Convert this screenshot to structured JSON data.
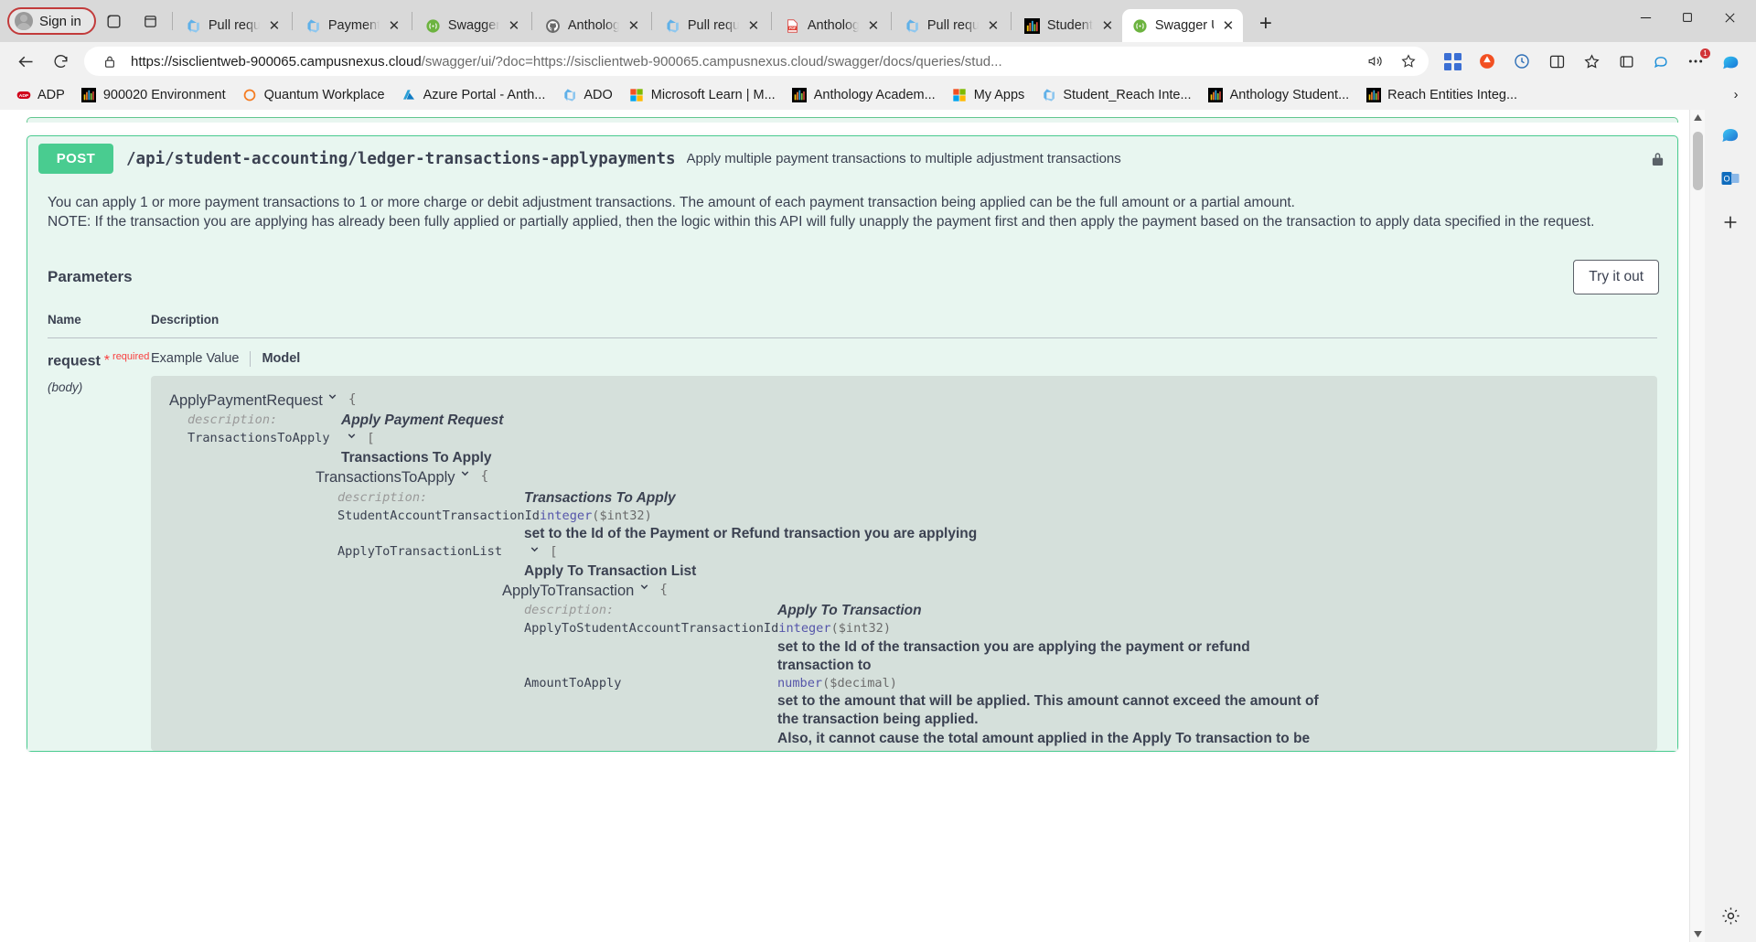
{
  "browser": {
    "signin_label": "Sign in",
    "tabs": [
      {
        "label": "Pull request",
        "favicon": "azure-devops-icon"
      },
      {
        "label": "PaymentSer",
        "favicon": "azure-devops-icon"
      },
      {
        "label": "Swagger Ed",
        "favicon": "swagger-icon"
      },
      {
        "label": "Anthology",
        "favicon": "github-icon"
      },
      {
        "label": "Pull request",
        "favicon": "azure-devops-icon"
      },
      {
        "label": "Anthology",
        "favicon": "pdf-icon"
      },
      {
        "label": "Pull request",
        "favicon": "azure-devops-icon"
      },
      {
        "label": "Student",
        "favicon": "powerbi-icon"
      },
      {
        "label": "Swagger UI",
        "favicon": "swagger-icon"
      }
    ],
    "active_tab_index": 8,
    "new_tab_label": "+",
    "window_controls": {
      "minimize": "–",
      "maximize": "□",
      "close": "✕"
    },
    "address": {
      "url_strong": "https://sisclientweb-900065.campusnexus.cloud",
      "url_dim": "/swagger/ui/?doc=https://sisclientweb-900065.campusnexus.cloud/swagger/docs/queries/stud...",
      "lock_icon": "lock-icon",
      "read_aloud_icon": "read-aloud-icon",
      "favorite_icon": "star-icon"
    },
    "toolbar_icons": [
      "collections-icon",
      "browser-essentials-icon",
      "split-screen-icon",
      "favorites-icon",
      "add-to-collections-icon",
      "copilot-icon",
      "extensions-icon",
      "settings-more-icon"
    ],
    "bookmarks": [
      {
        "label": "ADP",
        "icon": "adp-icon"
      },
      {
        "label": "900020 Environment",
        "icon": "powerbi-icon"
      },
      {
        "label": "Quantum Workplace",
        "icon": "quantum-icon"
      },
      {
        "label": "Azure Portal - Anth...",
        "icon": "azure-icon"
      },
      {
        "label": "ADO",
        "icon": "azure-devops-icon"
      },
      {
        "label": "Microsoft Learn | M...",
        "icon": "microsoft-icon"
      },
      {
        "label": "Anthology Academ...",
        "icon": "powerbi-icon"
      },
      {
        "label": "My Apps",
        "icon": "microsoft-icon"
      },
      {
        "label": "Student_Reach Inte...",
        "icon": "azure-devops-icon"
      },
      {
        "label": "Anthology Student...",
        "icon": "powerbi-icon"
      },
      {
        "label": "Reach Entities Integ...",
        "icon": "powerbi-icon"
      }
    ],
    "bookmarks_overflow": "›"
  },
  "swagger": {
    "operation": {
      "method": "POST",
      "path": "/api/student-accounting/ledger-transactions-applypayments",
      "summary": "Apply multiple payment transactions to multiple adjustment transactions",
      "lock_icon": "lock-icon",
      "description_line1": "You can apply 1 or more payment transactions to 1 or more charge or debit adjustment transactions. The amount of each payment transaction being applied can be the full amount or a partial amount.",
      "description_line2": "NOTE: If the transaction you are applying has already been fully applied or partially applied, then the logic within this API will fully unapply the payment first and then apply the payment based on the transaction to apply data specified in the request."
    },
    "parameters": {
      "heading": "Parameters",
      "try_it_out_label": "Try it out",
      "columns": {
        "name": "Name",
        "description": "Description"
      },
      "row": {
        "name": "request",
        "required_star": "*",
        "required_label": "required",
        "in": "(body)",
        "tabs": {
          "example": "Example Value",
          "model": "Model"
        }
      }
    },
    "model": {
      "root": {
        "class": "ApplyPaymentRequest",
        "brace": "{",
        "description_key": "description:",
        "description_value": "Apply Payment Request"
      },
      "nodes": [
        {
          "key": "TransactionsToApply",
          "bracket": "[",
          "title": "Transactions To Apply"
        },
        {
          "class": "TransactionsToApply",
          "brace": "{",
          "description_key": "description:",
          "description_value": "Transactions To Apply"
        },
        {
          "key": "StudentAccountTransactionId",
          "type": "integer",
          "format": "($int32)",
          "desc": "set to the Id of the Payment or Refund transaction you are applying"
        },
        {
          "key": "ApplyToTransactionList",
          "bracket": "[",
          "title": "Apply To Transaction List"
        },
        {
          "class": "ApplyToTransaction",
          "brace": "{",
          "description_key": "description:",
          "description_value": "Apply To Transaction"
        },
        {
          "key": "ApplyToStudentAccountTransactionId",
          "type": "integer",
          "format": "($int32)",
          "desc": "set to the Id of the transaction you are applying the payment or refund transaction to"
        },
        {
          "key": "AmountToApply",
          "type": "number",
          "format": "($decimal)",
          "desc": "set to the amount that will be applied. This amount cannot exceed the amount of the transaction being applied.",
          "desc2": "Also, it cannot cause the total amount applied in the Apply To transaction to be"
        }
      ]
    }
  },
  "right_rail": {
    "icons": [
      "copilot-icon",
      "outlook-icon",
      "add-app-icon",
      "settings-icon"
    ]
  },
  "colors": {
    "post_green": "#49cc90",
    "opblock_bg": "#e8f6f0",
    "model_bg": "#d5e0db",
    "required_red": "#f93e3e",
    "text": "#3b4151"
  }
}
